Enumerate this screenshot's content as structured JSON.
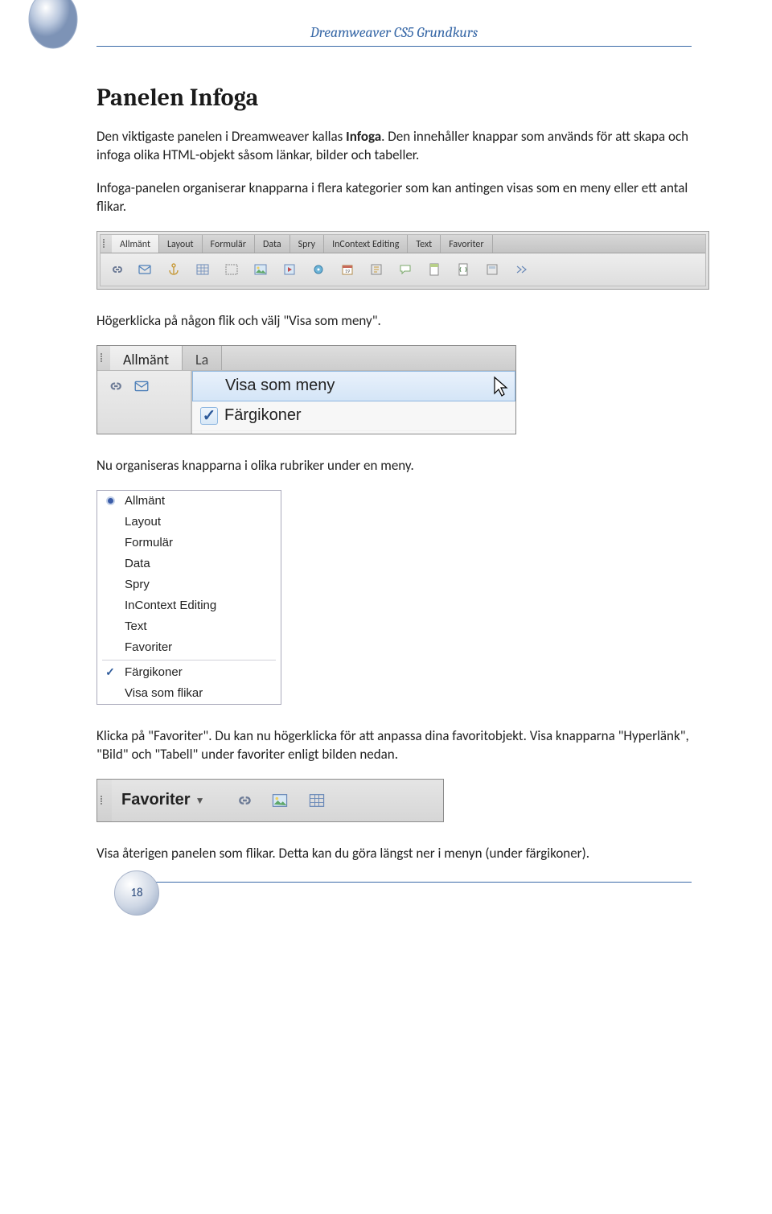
{
  "page": {
    "header": "Dreamweaver CS5 Grundkurs",
    "number": "18"
  },
  "h1": "Panelen Infoga",
  "p1_a": "Den viktigaste panelen i Dreamweaver kallas ",
  "p1_bold": "Infoga",
  "p1_b": ". Den innehåller knappar som används för att skapa och infoga olika HTML-objekt såsom länkar, bilder och tabeller.",
  "p2": "Infoga-panelen organiserar knapparna i flera kategorier som kan antingen visas som en meny eller ett antal flikar.",
  "shot1": {
    "tabs": [
      "Allmänt",
      "Layout",
      "Formulär",
      "Data",
      "Spry",
      "InContext Editing",
      "Text",
      "Favoriter"
    ]
  },
  "p3": "Högerklicka på någon flik och välj \"Visa som meny\".",
  "shot2": {
    "tab_a": "Allmänt",
    "tab_b": "La",
    "item_a": "Visa som meny",
    "item_b": "Färgikoner"
  },
  "p4": "Nu organiseras knapparna i olika rubriker under en meny.",
  "shot3": {
    "items_top": [
      "Allmänt",
      "Layout",
      "Formulär",
      "Data",
      "Spry",
      "InContext Editing",
      "Text",
      "Favoriter"
    ],
    "items_bottom": [
      "Färgikoner",
      "Visa som flikar"
    ]
  },
  "p5": "Klicka på \"Favoriter\". Du kan nu högerklicka för att anpassa dina favoritobjekt. Visa knapparna \"Hyperlänk\", \"Bild\" och \"Tabell\" under favoriter enligt bilden nedan.",
  "shot4": {
    "label": "Favoriter"
  },
  "p6": "Visa återigen panelen som flikar. Detta kan du göra längst ner i menyn (under färgikoner)."
}
